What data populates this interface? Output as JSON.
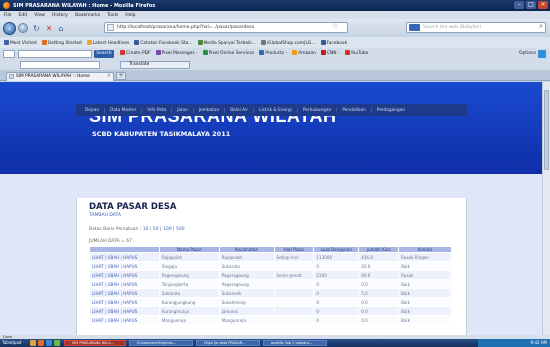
{
  "window": {
    "title": "SIM PRASARANA WILAYAH : Home - Mozilla Firefox"
  },
  "menu": [
    "File",
    "Edit",
    "View",
    "History",
    "Bookmarks",
    "Tools",
    "Help"
  ],
  "nav": {
    "url": "http://localhost/prasarana/home.php?hal=../pasar/pasardesa",
    "search_placeholder": "Search the web (Babylon)"
  },
  "bookmarks": [
    {
      "label": "Most Visited",
      "icon": "star-icon",
      "color": "#3b62a8"
    },
    {
      "label": "Getting Started",
      "icon": "firefox-icon",
      "color": "#e36b1b"
    },
    {
      "label": "Latest Headlines",
      "icon": "rss-icon",
      "color": "#f0a526"
    },
    {
      "label": "Catatan Facebook Sta...",
      "icon": "note-icon",
      "color": "#3b5998"
    },
    {
      "label": "Media Sparyal Terbaik...",
      "icon": "globe-icon",
      "color": "#4a8c36"
    },
    {
      "label": "iGlobalShop.com|LG...",
      "icon": "page-icon",
      "color": "#777777"
    },
    {
      "label": "Facebook",
      "icon": "facebook-icon",
      "color": "#3b5998"
    }
  ],
  "toolbar2": {
    "search_button": "Search",
    "items": [
      {
        "label": "Create PDF",
        "icon": "pdf-icon",
        "color": "#d43a2a"
      },
      {
        "label": "Pixel Messages -",
        "icon": "message-icon",
        "color": "#7a4ab0"
      },
      {
        "label": "Pixel Online Services",
        "icon": "pixel-icon",
        "color": "#2a8f3e"
      },
      {
        "label": "Products -",
        "icon": "product-icon",
        "color": "#2f66b3"
      },
      {
        "label": "Amazon",
        "icon": "amazon-icon",
        "color": "#f09a16"
      },
      {
        "label": "CNN -",
        "icon": "cnn-icon",
        "color": "#c21b1b"
      },
      {
        "label": "YouTube",
        "icon": "youtube-icon",
        "color": "#d62d20"
      }
    ],
    "options": "Options"
  },
  "toolbar3": {
    "translate": "Translate"
  },
  "tab": {
    "label": "SIM PRASARANA WILAYAH :: Home"
  },
  "site": {
    "title": "SIM PRASARANA WILAYAH",
    "subtitle": "SCBD KABUPATEN TASIKMALAYA 2011",
    "menu": [
      "Depan",
      "Data Master",
      "Info Peta",
      "Jalan",
      "Jembatan",
      "Balai Air",
      "Listrik & Energi",
      "Perhubungan",
      "Pendidikan",
      "Perdagangan"
    ]
  },
  "page": {
    "title": "DATA PASAR DESA",
    "add_link": "TAMBAH DATA",
    "limit_label": "Batas Baris Persatuan :",
    "limit_options": [
      "10",
      "50",
      "100",
      "500"
    ],
    "count_label": "JUMLAH DATA = 67"
  },
  "table": {
    "headers": [
      "",
      "Nama Pasar",
      "Kecamatan",
      "Hari Pasar",
      "Luas Bangunan",
      "Jumlah Kios",
      "Kondisi"
    ],
    "actions": [
      "LIHAT",
      "UBAH",
      "HAPUS"
    ],
    "rows": [
      [
        "Rajapolah",
        "Rajapolah",
        "Setiap hari",
        "113000",
        "436.0",
        "Rusak Ringan"
      ],
      [
        "Singaja",
        "Sukaratu",
        "",
        "0",
        "20.0",
        "Baik"
      ],
      [
        "Pagerageung",
        "Pagerageung",
        "Senin-Jumat",
        "2100",
        "60.0",
        "Rusak"
      ],
      [
        "Tanjungkerta",
        "Pagerageung",
        "",
        "0",
        "0.0",
        "Baik"
      ],
      [
        "Sukaratu",
        "Sukaresik",
        "",
        "0",
        "5.0",
        "Baik"
      ],
      [
        "Karangjungkung",
        "Sukahening",
        "",
        "0",
        "0.0",
        "Baik"
      ],
      [
        "Karangmulya",
        "Jamanis",
        "",
        "0",
        "0.0",
        "Baik"
      ],
      [
        "Mangunreja",
        "Mangunreja",
        "",
        "0",
        "0.0",
        "Baik"
      ]
    ]
  },
  "status": {
    "text": "Done"
  },
  "taskbar": {
    "start": "Tabletpad",
    "tasks": [
      "SIM PRASARANA WILA...",
      "D:\\sampah\\titi\\pedar...",
      "Hijau Ijo data PRASAR...",
      "ppakfa: tab 1 prasara..."
    ],
    "clock": "9:42 AM"
  }
}
